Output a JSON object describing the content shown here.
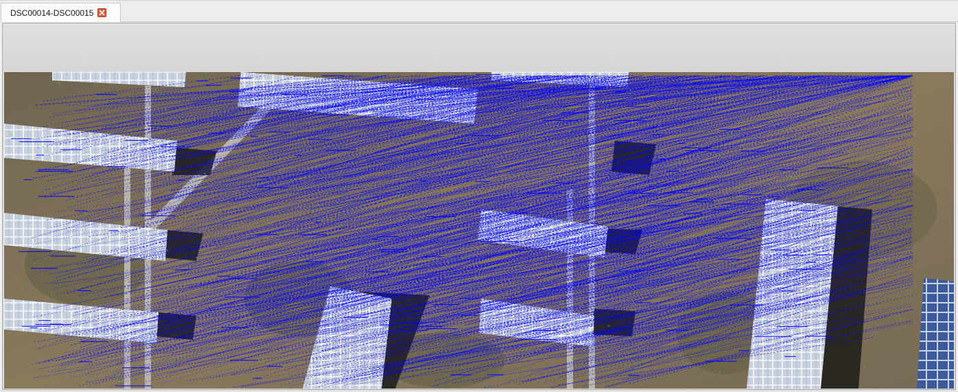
{
  "tabs": [
    {
      "label": "DSC00014-DSC00015",
      "active": true,
      "close_icon": "close-icon"
    }
  ],
  "viewer": {
    "content": "feature-match-visualization",
    "match_line_color": "#0000ff",
    "keypoint_color": "#2fd12f",
    "scene_ground_color": "#7a6b52",
    "panel_color": "#c9d0e0"
  }
}
